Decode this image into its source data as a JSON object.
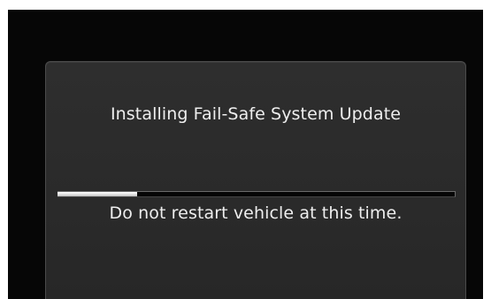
{
  "dialog": {
    "title": "Installing Fail-Safe System Update",
    "message": "Do not restart vehicle at this time.",
    "progress_fraction": 0.2
  },
  "colors": {
    "screen_background": "#060606",
    "dialog_background": "#2c2c2c",
    "text": "#eeeeee",
    "progress_fill": "#e9e9e9",
    "progress_track": "#050505"
  }
}
